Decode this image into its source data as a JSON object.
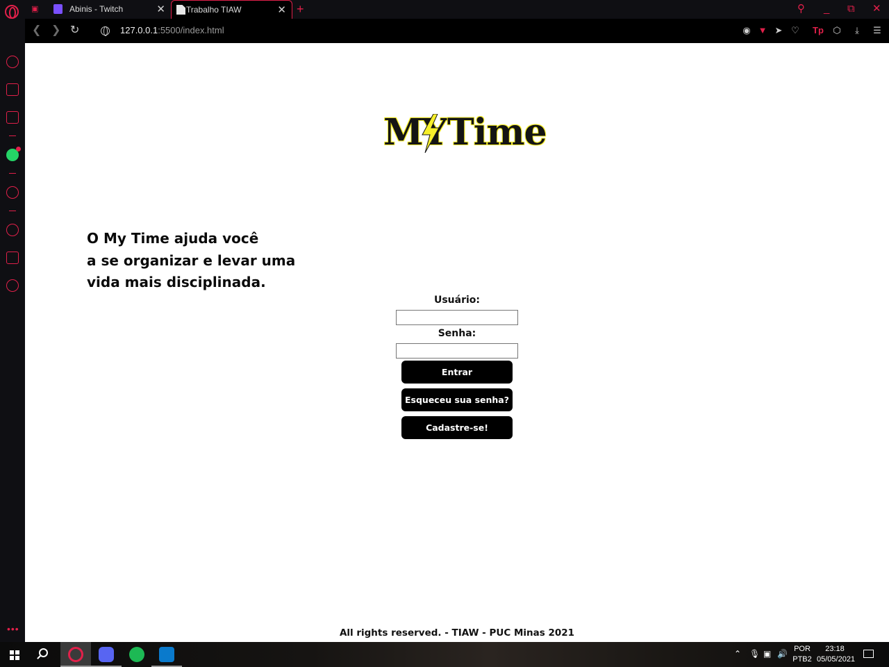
{
  "browser": {
    "tabs": [
      {
        "title": "Abinis - Twitch",
        "active": false
      },
      {
        "title": "Trabalho TIAW",
        "active": true
      }
    ],
    "address": {
      "host": "127.0.0.1",
      "path": ":5500/index.html"
    },
    "accent_color": "#e1204a"
  },
  "page": {
    "logo": {
      "word1": "MY",
      "word2": "Time"
    },
    "tagline": [
      "O My Time ajuda você",
      "a se organizar e levar uma",
      "vida mais disciplinada."
    ],
    "form": {
      "user_label": "Usuário:",
      "user_value": "",
      "password_label": "Senha:",
      "password_value": "",
      "login_button": "Entrar",
      "forgot_button": "Esqueceu sua senha?",
      "signup_button": "Cadastre-se!"
    },
    "footer": "All rights reserved. - TIAW - PUC Minas 2021"
  },
  "taskbar": {
    "apps": [
      "opera",
      "discord",
      "spotify",
      "vscode"
    ],
    "language": {
      "line1": "POR",
      "line2": "PTB2"
    },
    "time": "23:18",
    "date": "05/05/2021"
  }
}
